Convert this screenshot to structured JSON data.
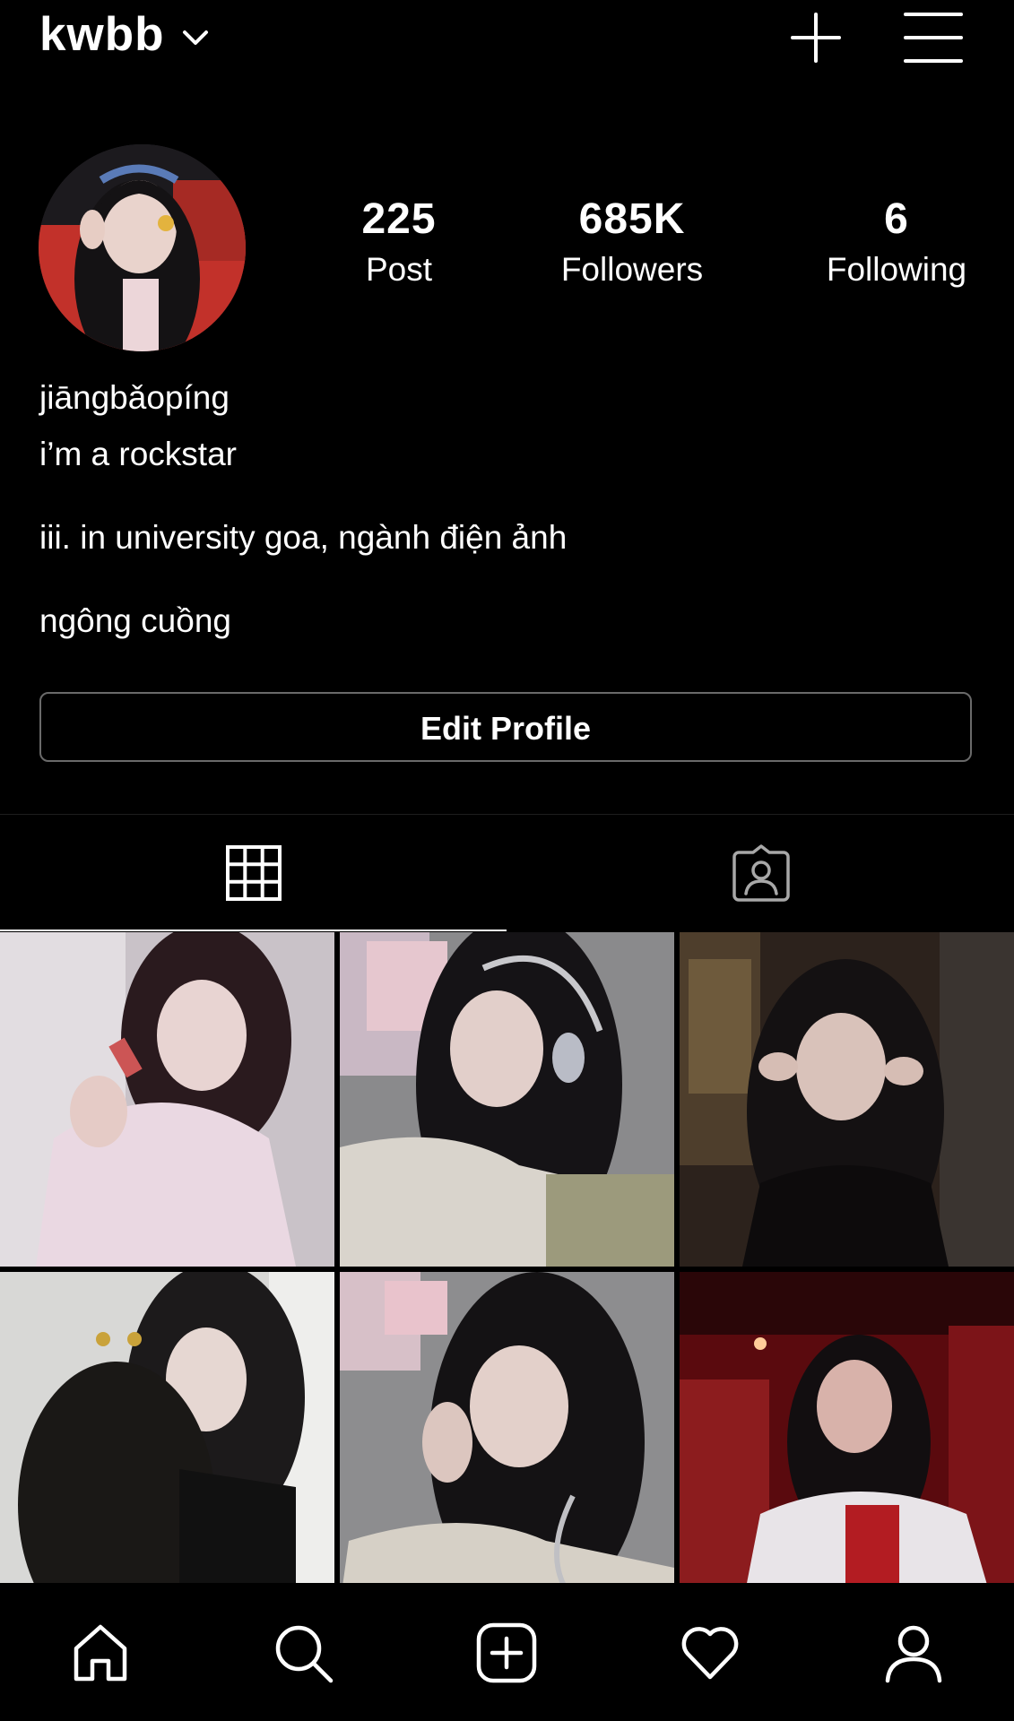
{
  "header": {
    "username": "kwbb",
    "icons": [
      "chevron-down-icon",
      "plus-icon",
      "menu-icon"
    ]
  },
  "profile": {
    "stats": [
      {
        "value": "225",
        "label": "Post"
      },
      {
        "value": "685K",
        "label": "Followers"
      },
      {
        "value": "6",
        "label": "Following"
      }
    ],
    "name": "jiāngbǎopíng",
    "bio": [
      "i’m a rockstar",
      "iii. in university goa, ngành điện ảnh",
      "ngông cuồng"
    ],
    "edit_button": "Edit Profile"
  },
  "tabs": [
    {
      "icon": "grid-icon",
      "active": true
    },
    {
      "icon": "tagged-icon",
      "active": false
    }
  ],
  "posts": [
    {
      "description": "photo"
    },
    {
      "description": "photo"
    },
    {
      "description": "photo"
    },
    {
      "description": "photo"
    },
    {
      "description": "photo"
    },
    {
      "description": "photo"
    }
  ],
  "bottom_nav": [
    "home-icon",
    "search-icon",
    "add-post-icon",
    "heart-icon",
    "profile-icon"
  ],
  "colors": {
    "background": "#000000",
    "text": "#ffffff",
    "button_border": "#6a6a6a"
  }
}
